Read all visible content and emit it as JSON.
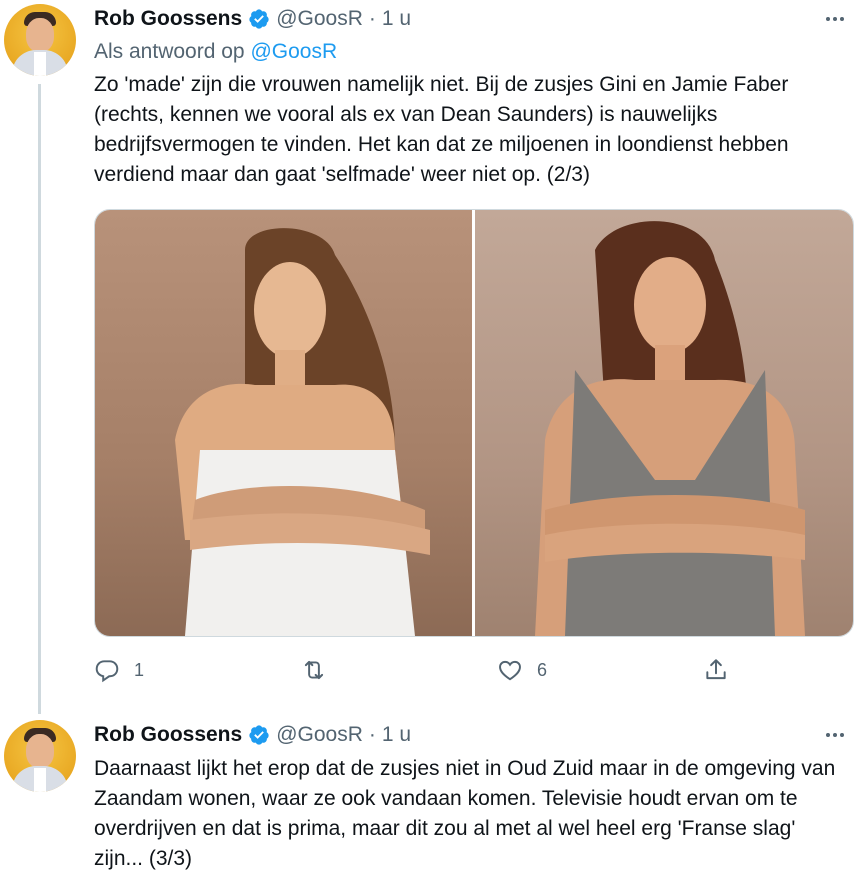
{
  "tweets": [
    {
      "author": {
        "name": "Rob Goossens",
        "handle": "@GoosR",
        "verified": true
      },
      "separator": "·",
      "time": "1 u",
      "reply_to": {
        "prefix": "Als antwoord op",
        "mention": "@GoosR"
      },
      "text": "Zo 'made' zijn die vrouwen namelijk niet. Bij de zusjes Gini en Jamie Faber (rechts, kennen we vooral als ex van Dean Saunders) is nauwelijks bedrijfsvermogen te vinden. Het kan dat ze miljoenen in loondienst hebben verdiend maar dan gaat 'selfmade' weer niet op. (2/3)",
      "media": [
        {
          "description_icon": "photo-woman-white-dress"
        },
        {
          "description_icon": "photo-woman-sequin-dress"
        }
      ],
      "actions": {
        "reply_count": "1",
        "retweet_count": "",
        "like_count": "6"
      }
    },
    {
      "author": {
        "name": "Rob Goossens",
        "handle": "@GoosR",
        "verified": true
      },
      "separator": "·",
      "time": "1 u",
      "text": "Daarnaast lijkt het erop dat de zusjes niet in Oud Zuid maar in de omgeving van Zaandam wonen, waar ze ook vandaan komen. Televisie houdt ervan om te overdrijven en dat is prima, maar dit zou al met al wel heel erg 'Franse slag' zijn... (3/3)"
    }
  ],
  "colors": {
    "accent": "#1d9bf0",
    "secondary_text": "#536471",
    "primary_text": "#0f1419",
    "thread_line": "#cfd9de"
  },
  "icons": [
    "verified-badge-icon",
    "more-icon",
    "reply-icon",
    "retweet-icon",
    "like-icon",
    "share-icon"
  ]
}
